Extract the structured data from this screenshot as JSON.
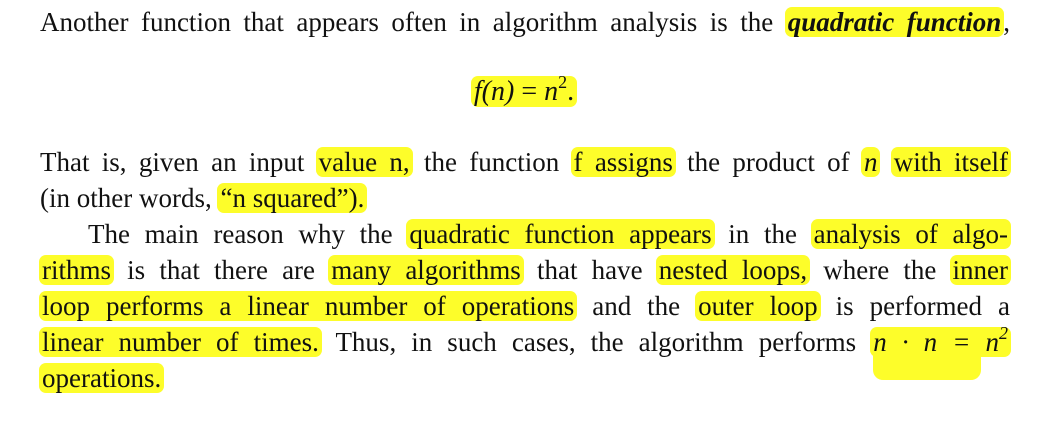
{
  "paragraph1": {
    "line1": {
      "text": "Another function that appears often in algorithm analysis is the",
      "term": "quadratic function",
      "tail": ","
    }
  },
  "equation": {
    "lhs": "f(n)",
    "eq": " = ",
    "base": "n",
    "exp": "2",
    "end": "."
  },
  "paragraph2": {
    "l1_a": "That is, given an input",
    "l1_hl1": "value n,",
    "l1_b": "the function",
    "l1_hl2": "f assigns",
    "l1_c": "the product of",
    "l1_hl3": "n",
    "l1_hl4": "with itself",
    "l2_a": "(in other words,",
    "l2_hl": "“n squared”).",
    "l3_a": "The main reason why the",
    "l3_hl1": "quadratic function appears",
    "l3_b": "in the",
    "l3_hl2": "analysis of algo-",
    "l4_hl1": "rithms",
    "l4_a": "is that there are",
    "l4_hl2": "many algorithms",
    "l4_b": "that have",
    "l4_hl3": "nested loops,",
    "l4_c": "where the",
    "l4_hl4": "inner",
    "l5_hl1": "loop performs a linear number of operations",
    "l5_a": "and the",
    "l5_hl2": "outer loop",
    "l5_b": "is performed a",
    "l6_hl1": "linear number of times.",
    "l6_a": "Thus, in such cases, the algorithm performs",
    "l6_hl2": "n · n = n",
    "l6_exp": "2",
    "l7_hl": "operations."
  }
}
